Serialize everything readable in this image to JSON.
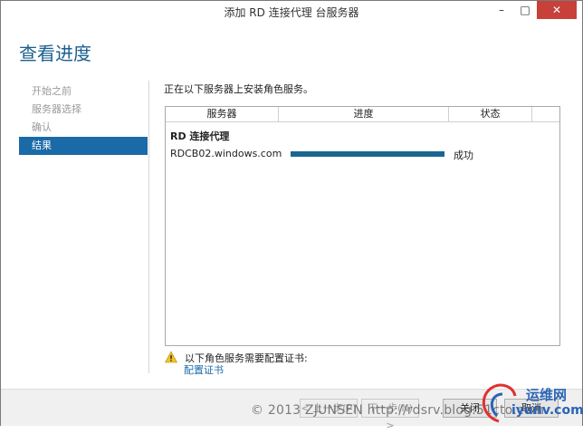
{
  "window": {
    "title": "添加 RD 连接代理 台服务器",
    "minimize": "–",
    "maximize": "□",
    "close": "✕"
  },
  "page": {
    "title": "查看进度"
  },
  "nav": {
    "items": [
      {
        "label": "开始之前",
        "active": false
      },
      {
        "label": "服务器选择",
        "active": false
      },
      {
        "label": "确认",
        "active": false
      },
      {
        "label": "结果",
        "active": true
      }
    ]
  },
  "main": {
    "intro": "正在以下服务器上安装角色服务。",
    "table": {
      "headers": [
        "服务器",
        "进度",
        "状态"
      ],
      "group": "RD 连接代理",
      "rows": [
        {
          "server": "RDCB02.windows.com",
          "progress": 1.0,
          "status": "成功"
        }
      ]
    }
  },
  "warning": {
    "icon": "warning-icon",
    "text": "以下角色服务需要配置证书:",
    "link": "配置证书"
  },
  "footer": {
    "prev": "< 上一步(P)",
    "next": "下一步(N) >",
    "close": "关闭",
    "cancel": "取消"
  },
  "watermark": "© 2013 ZJUNSEN http://rdsrv.blog.51cto.com",
  "logo": {
    "line1": "运维网",
    "line2": "iyunv.com"
  },
  "colors": {
    "accent": "#1b6aa8",
    "progress": "#1a6690",
    "close": "#c7403a"
  }
}
